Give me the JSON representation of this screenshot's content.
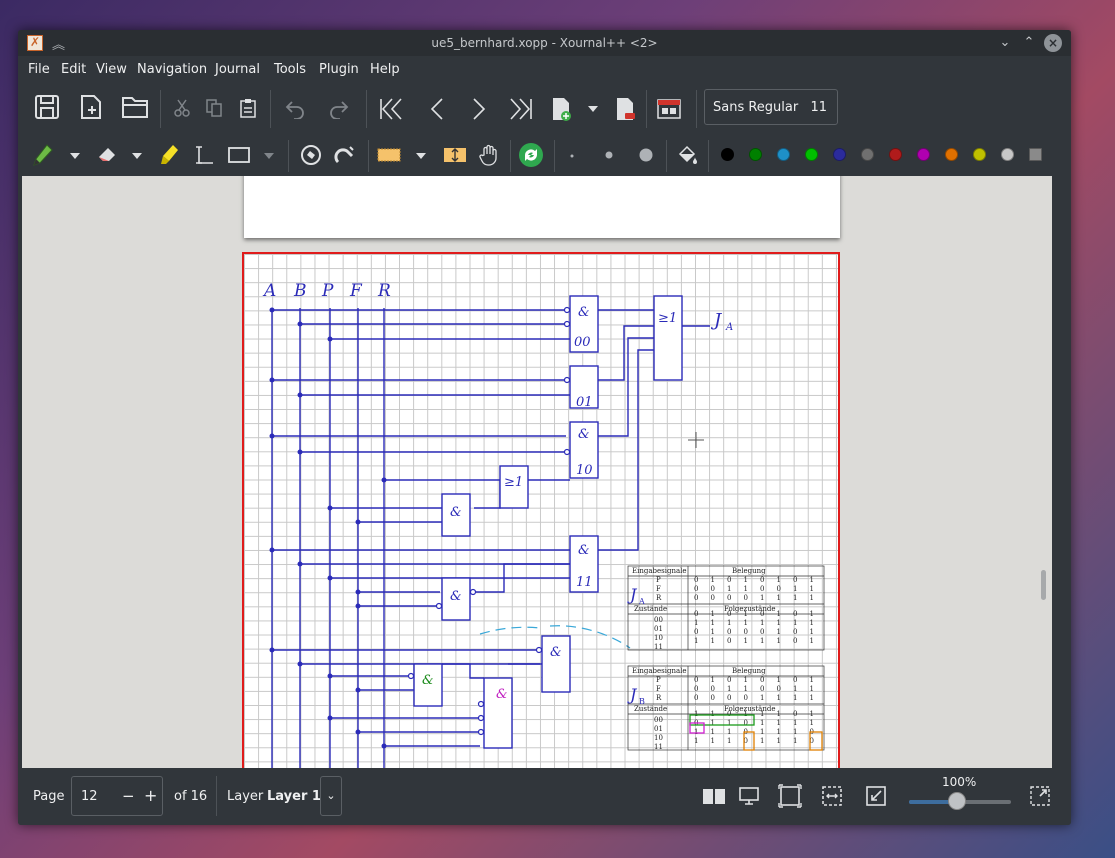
{
  "window": {
    "title": "ue5_bernhard.xopp - Xournal++ <2>"
  },
  "menu": [
    "File",
    "Edit",
    "View",
    "Navigation",
    "Journal",
    "Tools",
    "Plugin",
    "Help"
  ],
  "toolbar": {
    "font_name": "Sans Regular",
    "font_size": "11"
  },
  "palette": [
    "#000000",
    "#008000",
    "#1e90c8",
    "#00c000",
    "#2b2b9c",
    "#707070",
    "#b01b1b",
    "#b000b0",
    "#e07000",
    "#c0c000",
    "#c8c8c8",
    "#8a8a8a"
  ],
  "drawing": {
    "inputs": [
      "A",
      "B",
      "P",
      "F",
      "R"
    ],
    "gates": [
      "&",
      "00",
      "01",
      "&",
      "10",
      "&",
      "11",
      "&",
      "&",
      "&",
      "&",
      "&",
      "&"
    ],
    "or_gates": [
      "≥1",
      "≥1"
    ],
    "output_a": "J",
    "output_a_sub": "A",
    "output_b": "J",
    "output_b_sub": "B"
  },
  "tables": {
    "header_left": "Eingabesignale",
    "header_right": "Belegung",
    "row_labels": [
      "P",
      "F",
      "R"
    ],
    "row_values": [
      [
        "0",
        "1",
        "0",
        "1",
        "0",
        "1",
        "0",
        "1"
      ],
      [
        "0",
        "0",
        "1",
        "1",
        "0",
        "0",
        "1",
        "1"
      ],
      [
        "0",
        "0",
        "0",
        "0",
        "1",
        "1",
        "1",
        "1"
      ]
    ],
    "states_left": "Zustände",
    "states_right": "Folgezustände",
    "states": [
      "00",
      "01",
      "10",
      "11"
    ],
    "table_a_next": [
      [
        "0",
        "1",
        "0",
        "1",
        "0",
        "1",
        "0",
        "1"
      ],
      [
        "1",
        "1",
        "1",
        "1",
        "1",
        "1",
        "1",
        "1"
      ],
      [
        "0",
        "1",
        "0",
        "0",
        "0",
        "1",
        "0",
        "1"
      ],
      [
        "1",
        "1",
        "0",
        "1",
        "1",
        "1",
        "0",
        "1"
      ]
    ],
    "table_b_next": [
      [
        "1",
        "1",
        "0",
        "1",
        "1",
        "1",
        "0",
        "1"
      ],
      [
        "0",
        "1",
        "1",
        "0",
        "1",
        "1",
        "1",
        "1"
      ],
      [
        "1",
        "1",
        "1",
        "0",
        "1",
        "1",
        "1",
        "0"
      ],
      [
        "1",
        "1",
        "1",
        "0",
        "1",
        "1",
        "1",
        "0"
      ]
    ]
  },
  "statusbar": {
    "page_label": "Page",
    "page_value": "12",
    "of_label": "of 16",
    "layer_label": "Layer",
    "layer_value": "Layer 1",
    "zoom_label": "100%",
    "zoom_fraction": 0.47
  }
}
